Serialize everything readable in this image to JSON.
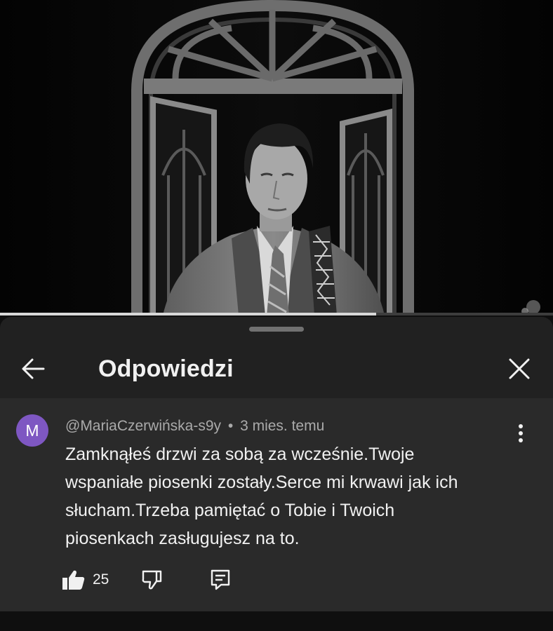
{
  "sheet": {
    "title": "Odpowiedzi"
  },
  "video": {
    "progress_fraction": 0.68
  },
  "comment": {
    "avatar_letter": "M",
    "avatar_color": "#7e57c2",
    "author": "@MariaCzerwińska-s9y",
    "separator": "•",
    "time": "3 mies. temu",
    "text": "Zamknąłeś drzwi za sobą za wcześnie.Twoje wspaniałe piosenki zostały.Serce mi krwawi jak ich słucham.Trzeba pamiętać o Tobie i Twoich piosenkach zasługujesz na to.",
    "likes": "25"
  },
  "icons": {
    "back": "arrow-left-icon",
    "close": "close-icon",
    "more": "more-vertical-icon",
    "like": "thumbs-up-filled-icon",
    "dislike": "thumbs-down-icon",
    "reply": "reply-comment-icon"
  }
}
